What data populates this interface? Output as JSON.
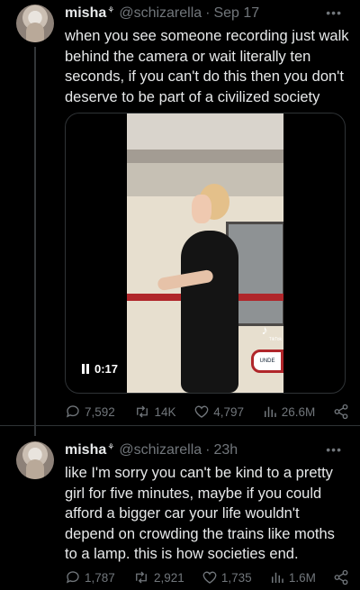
{
  "tweets": [
    {
      "name": "misha",
      "badge": "⚘",
      "handle": "@schizarella",
      "time": "Sep 17",
      "text": "when you see someone recording just walk behind the camera or wait literally ten seconds, if you can't do this then you don't deserve to be part of a civilized society",
      "video": {
        "duration": "0:17",
        "watermark": "TikTok",
        "sign": "UNDE"
      },
      "stats": {
        "replies": "7,592",
        "retweets": "14K",
        "likes": "4,797",
        "views": "26.6M"
      }
    },
    {
      "name": "misha",
      "badge": "⚘",
      "handle": "@schizarella",
      "time": "23h",
      "text": "like I'm sorry you can't be kind to a pretty girl for five minutes, maybe if you could afford a bigger car your life wouldn't depend on crowding the trains like moths to a lamp. this is how societies end.",
      "stats": {
        "replies": "1,787",
        "retweets": "2,921",
        "likes": "1,735",
        "views": "1.6M"
      }
    }
  ],
  "icons": {
    "reply": "reply-icon",
    "retweet": "retweet-icon",
    "like": "heart-icon",
    "views": "views-icon",
    "share": "share-icon",
    "more": "more-icon",
    "pause": "pause-icon"
  },
  "colors": {
    "background": "#000000",
    "text": "#e7e9ea",
    "muted": "#71767b",
    "border": "#2f3336"
  }
}
